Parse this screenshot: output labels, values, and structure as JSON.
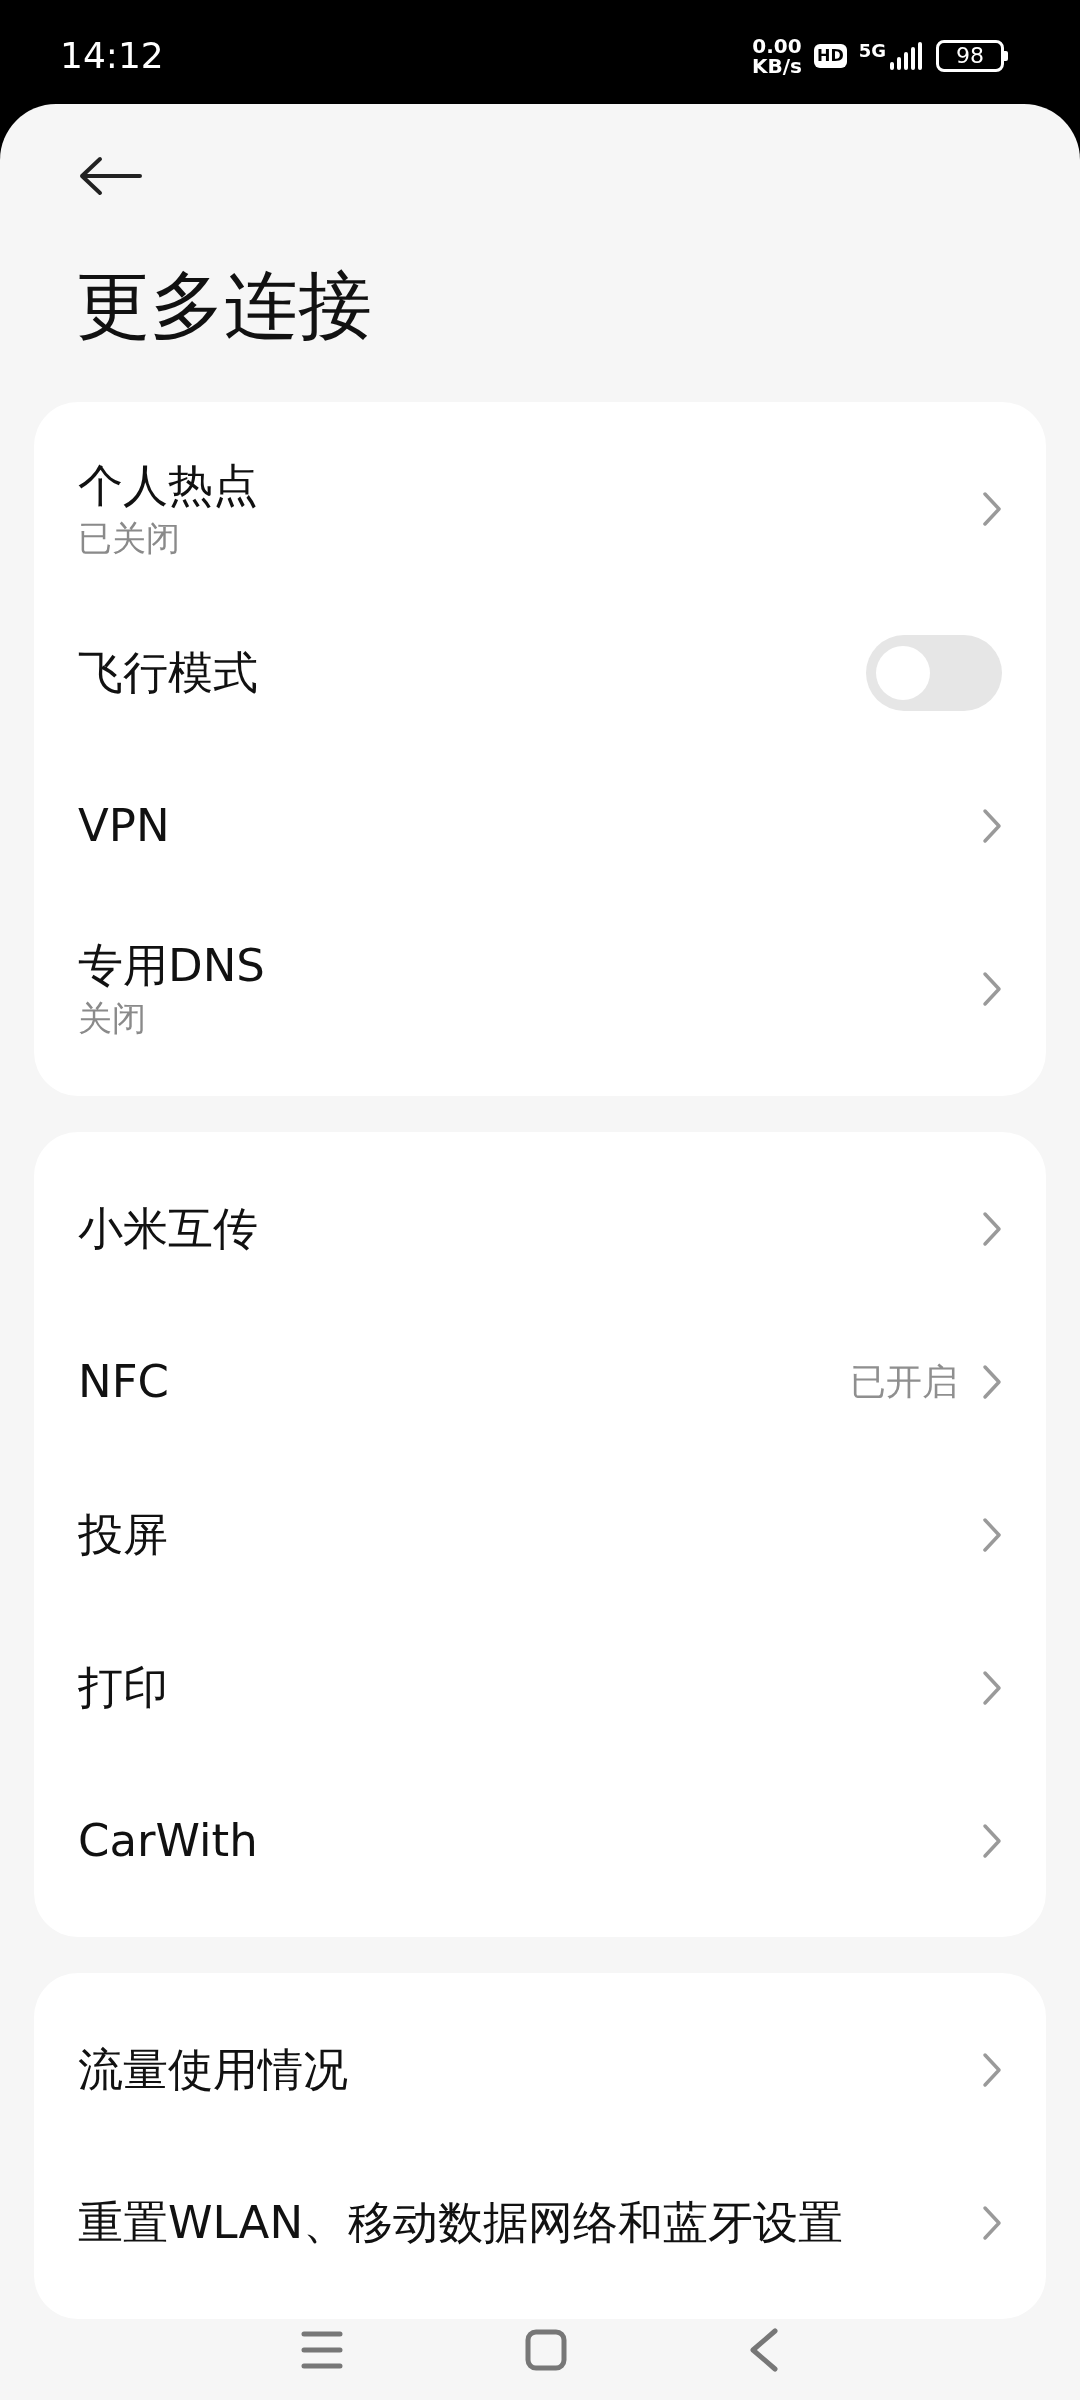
{
  "status_bar": {
    "time": "14:12",
    "speed_value": "0.00",
    "speed_unit": "KB/s",
    "hd": "HD",
    "network": "5G",
    "battery": "98"
  },
  "title": "更多连接",
  "groups": [
    {
      "items": [
        {
          "kind": "nav",
          "label": "个人热点",
          "subtitle": "已关闭"
        },
        {
          "kind": "toggle",
          "label": "飞行模式",
          "on": false
        },
        {
          "kind": "nav",
          "label": "VPN"
        },
        {
          "kind": "nav",
          "label": "专用DNS",
          "subtitle": "关闭"
        }
      ]
    },
    {
      "items": [
        {
          "kind": "nav",
          "label": "小米互传"
        },
        {
          "kind": "nav",
          "label": "NFC",
          "value": "已开启"
        },
        {
          "kind": "nav",
          "label": "投屏"
        },
        {
          "kind": "nav",
          "label": "打印"
        },
        {
          "kind": "nav",
          "label": "CarWith"
        }
      ]
    },
    {
      "items": [
        {
          "kind": "nav",
          "label": "流量使用情况"
        },
        {
          "kind": "nav",
          "label": "重置WLAN、移动数据网络和蓝牙设置"
        }
      ]
    }
  ]
}
